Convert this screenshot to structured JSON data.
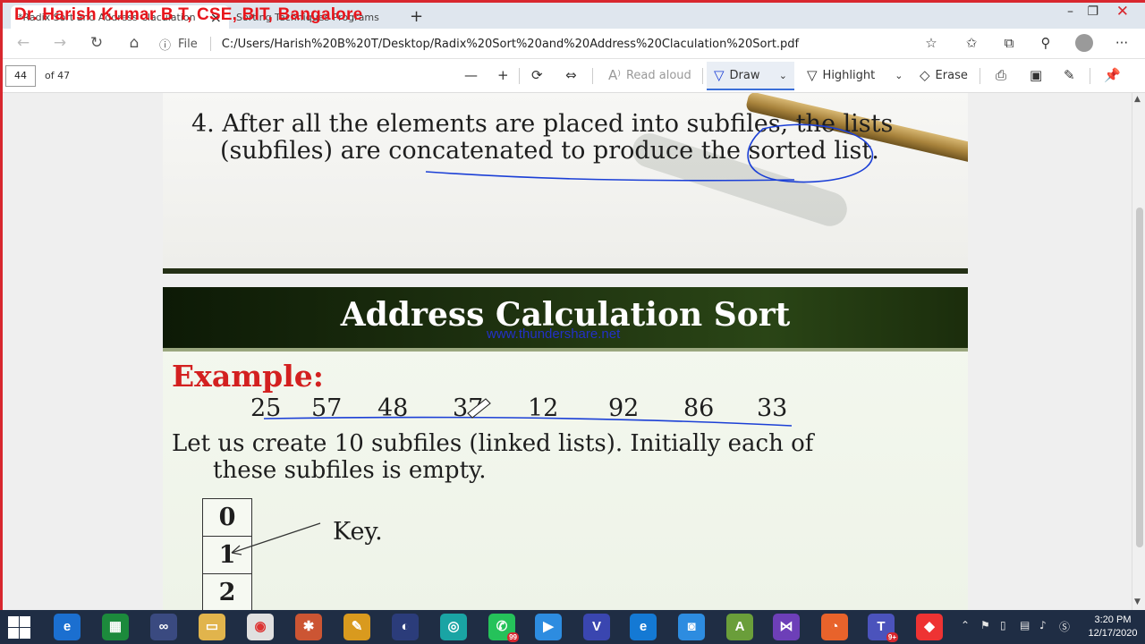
{
  "overlay_title": "Dr. Harish Kumar B T, CSE, BIT, Bangalore",
  "tabs": [
    {
      "label": "*Radix Sort and Address Claculation"
    },
    {
      "label": "Sorting Techniques Programs"
    }
  ],
  "address_bar": {
    "scheme_label": "File",
    "url": "C:/Users/Harish%20B%20T/Desktop/Radix%20Sort%20and%20Address%20Claculation%20Sort.pdf"
  },
  "pdf_toolbar": {
    "page_number": "44",
    "page_total": "of 47",
    "read_aloud": "Read aloud",
    "draw": "Draw",
    "highlight": "Highlight",
    "erase": "Erase"
  },
  "slide1": {
    "point_line1": "4. After all the elements are placed into subfiles, the lists",
    "point_line2": "(subfiles) are concatenated to produce the sorted list."
  },
  "slide2": {
    "title": "Address Calculation Sort",
    "watermark": "www.thundershare.net",
    "example_label": "Example:",
    "numbers": [
      "25",
      "57",
      "48",
      "37",
      "12",
      "92",
      "86",
      "33"
    ],
    "desc_line1": "Let us create 10 subfiles (linked lists). Initially each of",
    "desc_line2": "these subfiles is empty.",
    "buckets": [
      "0",
      "1",
      "2"
    ],
    "key_label": "Key."
  },
  "colors": {
    "accent_red": "#d8272e",
    "ink_blue": "#1b3fd6",
    "header_green": "#1f3310",
    "example_red": "#d32020"
  },
  "icons": [
    "back-icon",
    "forward-icon",
    "refresh-icon",
    "home-icon",
    "info-icon",
    "star-icon",
    "favorites-icon",
    "collections-icon",
    "share-icon",
    "more-icon",
    "zoom-out-icon",
    "zoom-in-icon",
    "rotate-icon",
    "fit-page-icon",
    "print-icon",
    "save-icon",
    "save-as-icon",
    "pin-icon"
  ],
  "taskbar": {
    "whatsapp_badge": "99",
    "teams_badge": "9+",
    "time": "3:20 PM",
    "date": "12/17/2020"
  }
}
